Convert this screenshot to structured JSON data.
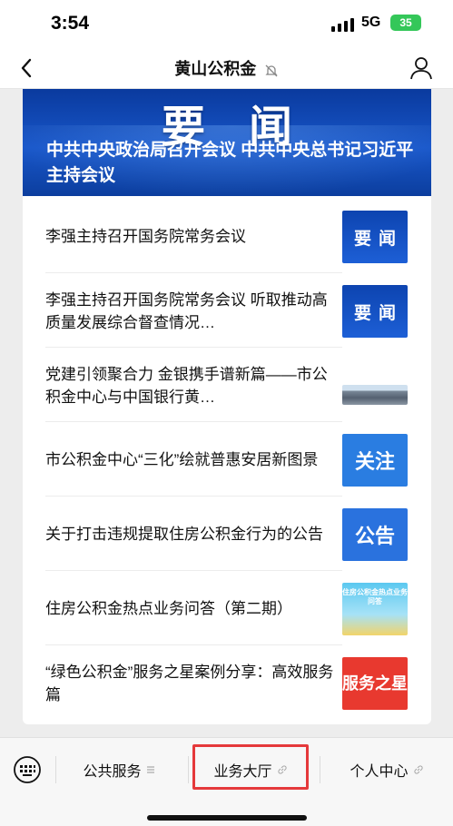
{
  "status_bar": {
    "time": "3:54",
    "network": "5G",
    "battery": "35"
  },
  "nav": {
    "title": "黄山公积金"
  },
  "banner": {
    "heading": "要闻",
    "caption": "中共中央政治局召开会议 中共中央总书记习近平主持会议"
  },
  "news": [
    {
      "title": "李强主持召开国务院常务会议",
      "thumb": "要闻"
    },
    {
      "title": "李强主持召开国务院常务会议 听取推动高质量发展综合督查情况…",
      "thumb": "要闻"
    },
    {
      "title": "党建引领聚合力 金银携手谱新篇——市公积金中心与中国银行黄…",
      "thumb": ""
    },
    {
      "title": "市公积金中心“三化”绘就普惠安居新图景",
      "thumb": "关注"
    },
    {
      "title": "关于打击违规提取住房公积金行为的公告",
      "thumb": "公告"
    },
    {
      "title": "住房公积金热点业务问答（第二期）",
      "thumb": "住房公积金热点业务问答"
    },
    {
      "title": "“绿色公积金”服务之星案例分享：高效服务篇",
      "thumb": "服务之星"
    }
  ],
  "menu": {
    "item1": "公共服务",
    "item2": "业务大厅",
    "item3": "个人中心"
  },
  "colors": {
    "highlight": "#e5393b",
    "banner": "#1856c9"
  },
  "icons": [
    "back-chevron-icon",
    "mute-bell-icon",
    "person-icon",
    "keyboard-icon",
    "menu-lines-icon",
    "link-icon"
  ]
}
